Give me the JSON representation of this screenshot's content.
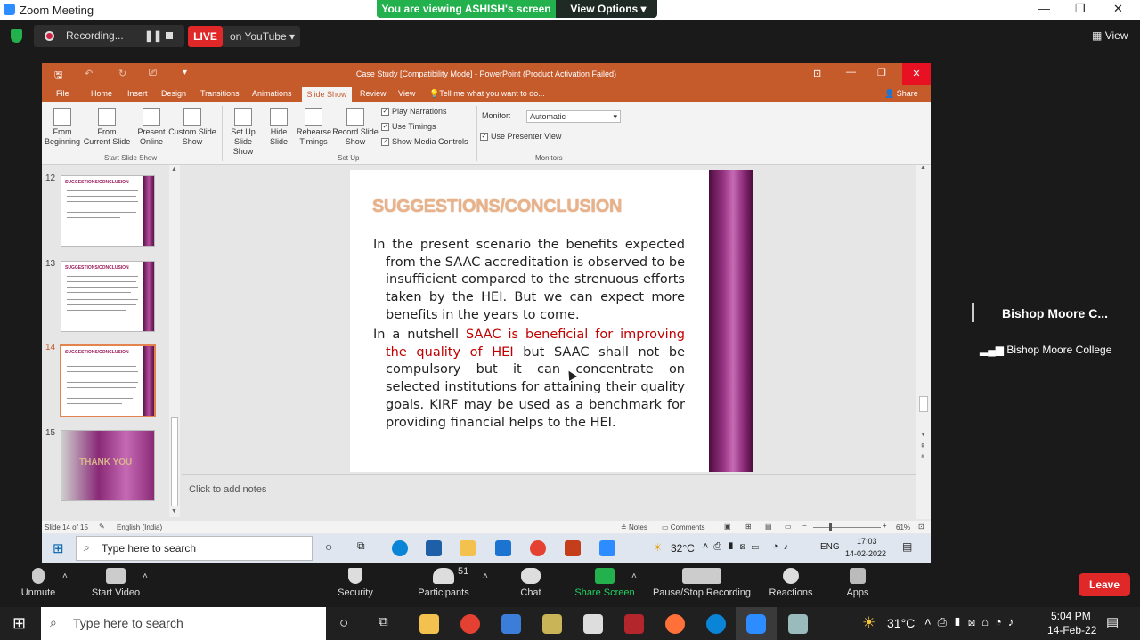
{
  "zoom": {
    "title": "Zoom Meeting",
    "viewing": "You are viewing ASHISH's screen",
    "view_options": "View Options",
    "recording": "Recording...",
    "live": "LIVE",
    "stream": "on YouTube",
    "view": "View"
  },
  "ppt": {
    "title": "Case Study [Compatibility Mode] - PowerPoint (Product Activation Failed)",
    "tabs": [
      "File",
      "Home",
      "Insert",
      "Design",
      "Transitions",
      "Animations",
      "Slide Show",
      "Review",
      "View"
    ],
    "tell_me": "Tell me what you want to do...",
    "share": "Share",
    "ribbon": {
      "from_beginning": [
        "From",
        "Beginning"
      ],
      "from_current": [
        "From",
        "Current Slide"
      ],
      "present_online": [
        "Present",
        "Online"
      ],
      "custom_show": [
        "Custom Slide",
        "Show"
      ],
      "group1": "Start Slide Show",
      "setup_show": [
        "Set Up",
        "Slide Show"
      ],
      "hide_slide": [
        "Hide",
        "Slide"
      ],
      "rehearse": [
        "Rehearse",
        "Timings"
      ],
      "record": [
        "Record Slide",
        "Show"
      ],
      "play_narrations": "Play Narrations",
      "use_timings": "Use Timings",
      "show_media": "Show Media Controls",
      "group2": "Set Up",
      "monitor_label": "Monitor:",
      "monitor_value": "Automatic",
      "presenter_view": "Use Presenter View",
      "group3": "Monitors"
    },
    "thumbs": [
      {
        "num": "12",
        "title": "SUGGESTIONS/CONCLUSION"
      },
      {
        "num": "13",
        "title": "SUGGESTIONS/CONCLUSION"
      },
      {
        "num": "14",
        "title": "SUGGESTIONS/CONCLUSION"
      },
      {
        "num": "15",
        "title": "THANK YOU"
      }
    ],
    "slide": {
      "title": "SUGGESTIONS/CONCLUSION",
      "p1": "In the present scenario the benefits expected from the SAAC accreditation is observed to be insufficient compared to the strenuous efforts taken by the HEI. But we can expect more benefits in the years to come.",
      "p2_a": "In a nutshell ",
      "p2_red": "SAAC is beneficial for improving the quality of HEI",
      "p2_b": " but SAAC shall not be compulsory but it can concentrate on selected institutions for attaining their quality goals. KIRF may be used as a benchmark for providing financial helps to the HEI."
    },
    "notes": "Click to add notes",
    "status": {
      "slide": "Slide 14 of 15",
      "lang": "English (India)",
      "notes": "Notes",
      "comments": "Comments",
      "zoom": "61%"
    },
    "taskbar": {
      "search": "Type here to search",
      "temp": "32°C",
      "lang": "ENG",
      "time": "17:03",
      "date": "14-02-2022"
    }
  },
  "speaker": {
    "name": "Bishop Moore C...",
    "label": "Bishop Moore College"
  },
  "toolbar": {
    "unmute": "Unmute",
    "video": "Start Video",
    "security": "Security",
    "participants": "Participants",
    "count": "51",
    "chat": "Chat",
    "share": "Share Screen",
    "rec": "Pause/Stop Recording",
    "reactions": "Reactions",
    "apps": "Apps",
    "leave": "Leave"
  },
  "win": {
    "search": "Type here to search",
    "temp": "31°C",
    "time": "5:04 PM",
    "date": "14-Feb-22"
  }
}
